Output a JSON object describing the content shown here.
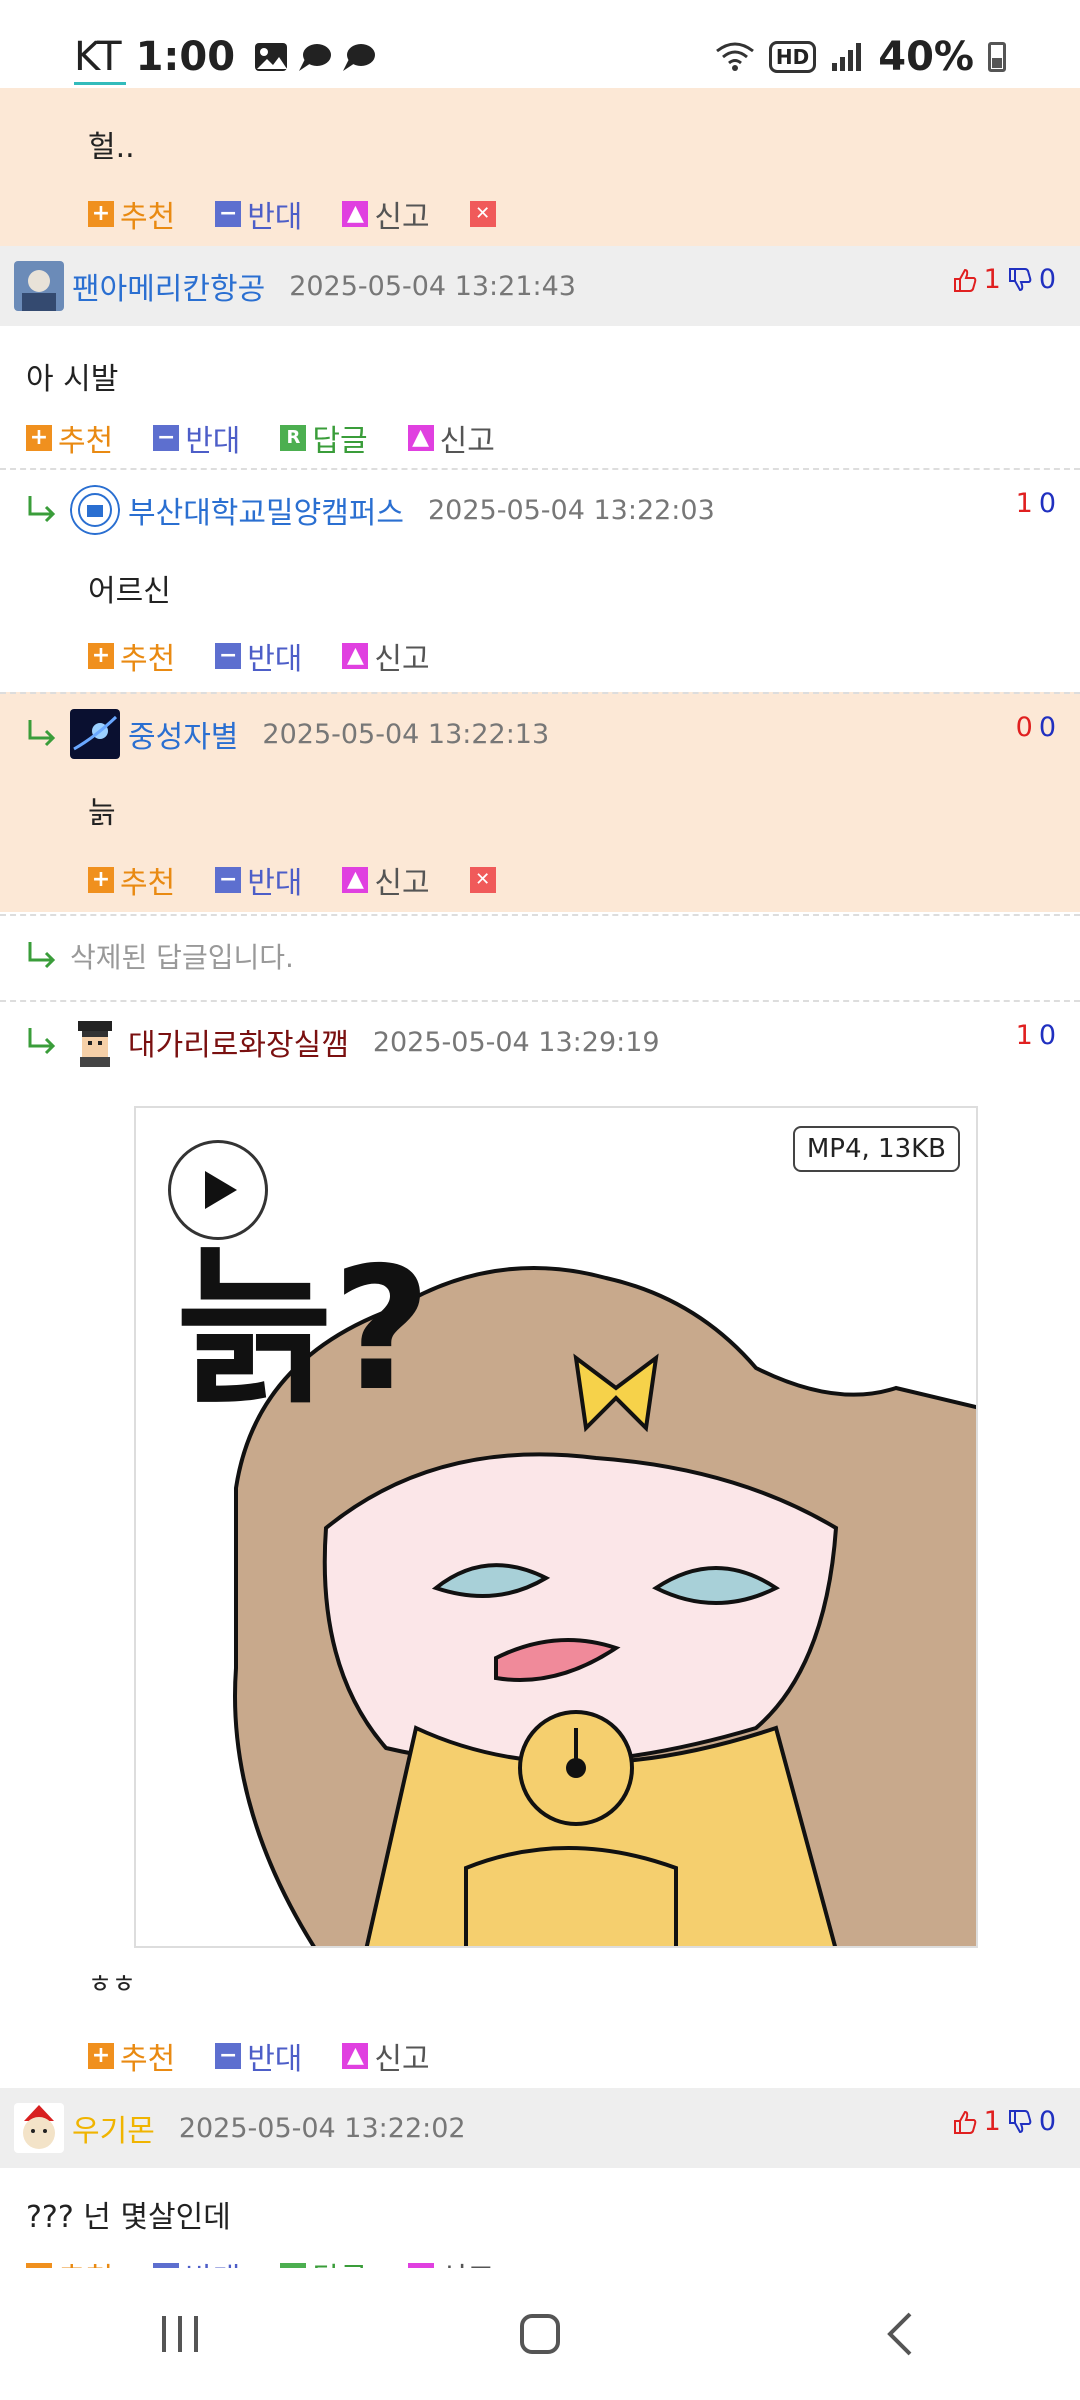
{
  "status_bar": {
    "carrier": "KT",
    "time": "1:00",
    "hd": "HD",
    "battery": "40%"
  },
  "comments": [
    {
      "type": "reply-continued",
      "text": "헐..",
      "actions": {
        "recommend": "추천",
        "oppose": "반대",
        "report": "신고"
      }
    },
    {
      "type": "comment",
      "nick": "팬아메리칸항공",
      "date": "2025-05-04 13:21:43",
      "up": "1",
      "down": "0",
      "text": "아 시발",
      "actions": {
        "recommend": "추천",
        "oppose": "반대",
        "reply": "답글",
        "report": "신고"
      }
    },
    {
      "type": "reply",
      "nick": "부산대학교밀양캠퍼스",
      "date": "2025-05-04 13:22:03",
      "up": "1",
      "down": "0",
      "text": "어르신",
      "actions": {
        "recommend": "추천",
        "oppose": "반대",
        "report": "신고"
      }
    },
    {
      "type": "reply",
      "nick": "중성자별",
      "date": "2025-05-04 13:22:13",
      "up": "0",
      "down": "0",
      "text": "늙",
      "actions": {
        "recommend": "추천",
        "oppose": "반대",
        "report": "신고"
      }
    },
    {
      "type": "deleted",
      "text": "삭제된 답글입니다."
    },
    {
      "type": "reply",
      "nick": "대가리로화장실깸",
      "date": "2025-05-04 13:29:19",
      "up": "1",
      "down": "0",
      "video_badge": "MP4,  13KB",
      "caption": "늙?",
      "text": "ㅎㅎ",
      "actions": {
        "recommend": "추천",
        "oppose": "반대",
        "report": "신고"
      }
    },
    {
      "type": "comment",
      "nick": "우기몬",
      "date": "2025-05-04 13:22:02",
      "up": "1",
      "down": "0",
      "text": "??? 넌 몇살인데",
      "actions": {
        "recommend": "추천",
        "oppose": "반대",
        "reply": "답글",
        "report": "신고"
      }
    }
  ]
}
